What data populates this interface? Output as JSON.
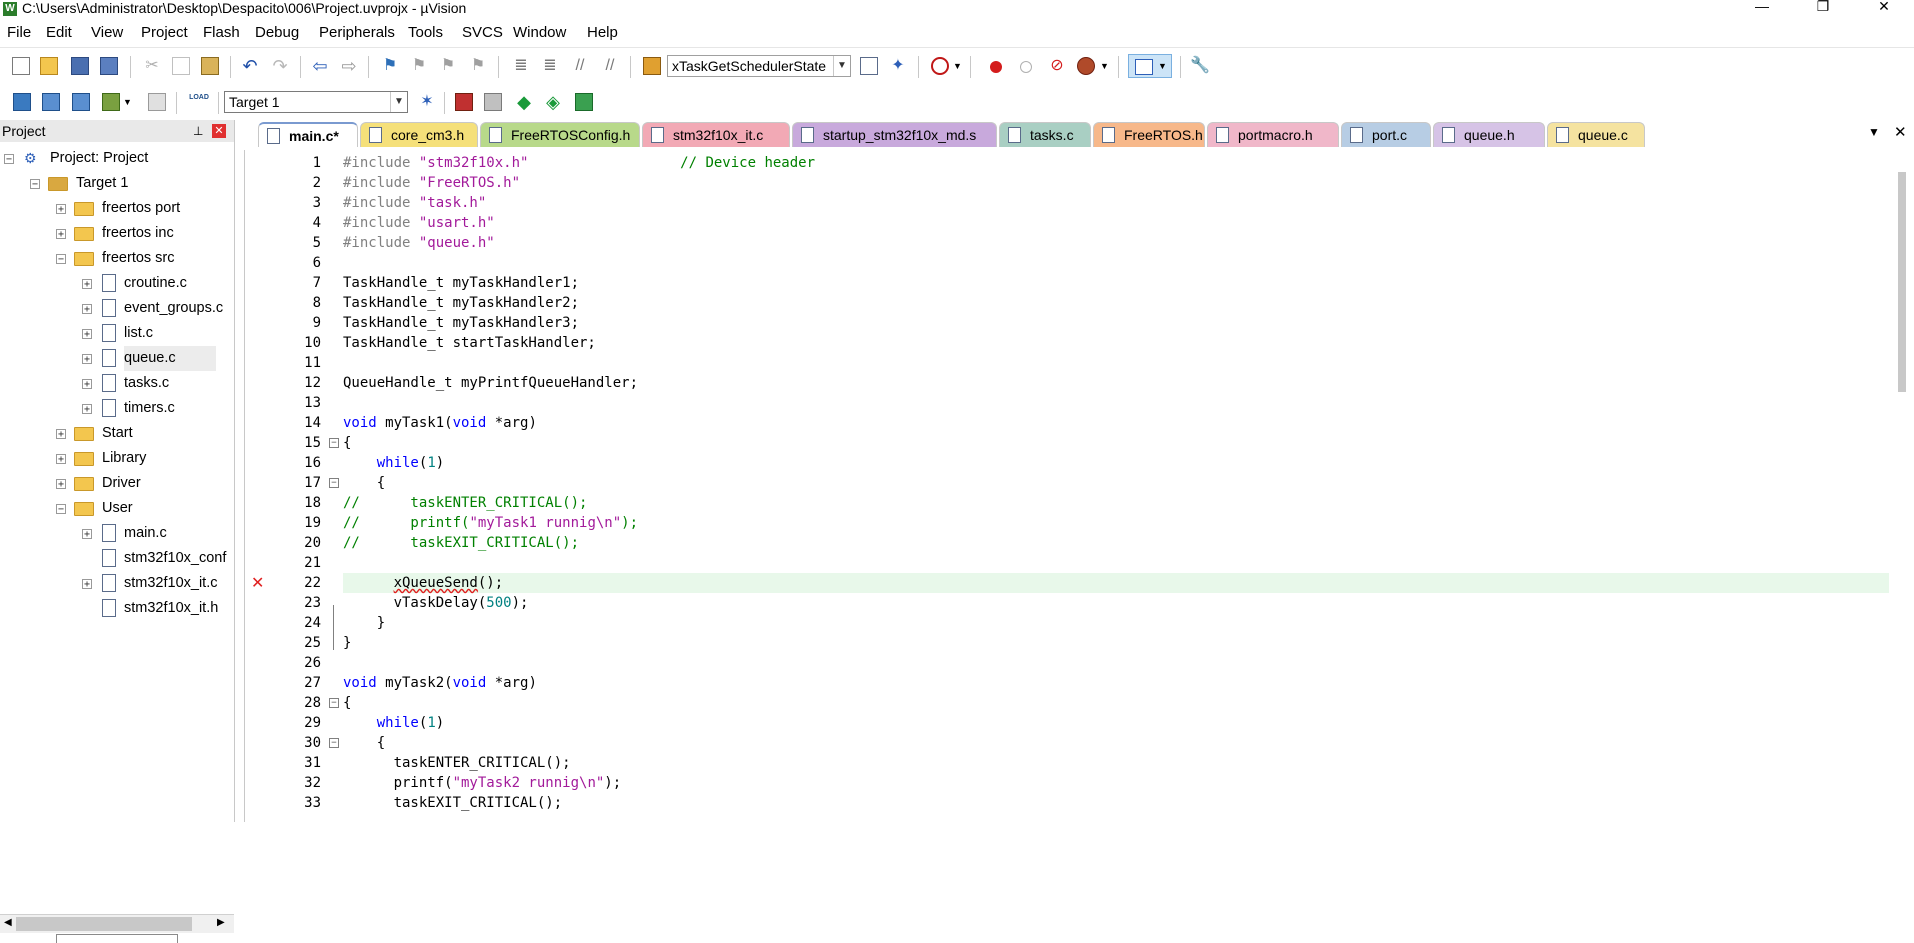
{
  "window": {
    "title": "C:\\Users\\Administrator\\Desktop\\Despacito\\006\\Project.uvprojx - µVision",
    "app_icon": "W",
    "controls": [
      "—",
      "❐",
      "✕"
    ]
  },
  "menu": [
    "File",
    "Edit",
    "View",
    "Project",
    "Flash",
    "Debug",
    "Peripherals",
    "Tools",
    "SVCS",
    "Window",
    "Help"
  ],
  "toolbar": {
    "find_combo": "xTaskGetSchedulerState",
    "target_combo": "Target 1"
  },
  "project_panel": {
    "title": "Project",
    "pin": "⊥",
    "close": "✕",
    "tree": [
      {
        "label": "Project: Project",
        "level": 0,
        "kind": "project",
        "exp": "−"
      },
      {
        "label": "Target 1",
        "level": 1,
        "kind": "target",
        "exp": "−"
      },
      {
        "label": "freertos port",
        "level": 2,
        "kind": "folder",
        "exp": "+"
      },
      {
        "label": "freertos inc",
        "level": 2,
        "kind": "folder",
        "exp": "+"
      },
      {
        "label": "freertos src",
        "level": 2,
        "kind": "folder-open",
        "exp": "−"
      },
      {
        "label": "croutine.c",
        "level": 3,
        "kind": "file",
        "exp": "+"
      },
      {
        "label": "event_groups.c",
        "level": 3,
        "kind": "file",
        "exp": "+"
      },
      {
        "label": "list.c",
        "level": 3,
        "kind": "file",
        "exp": "+"
      },
      {
        "label": "queue.c",
        "level": 3,
        "kind": "file",
        "exp": "+",
        "selected": true
      },
      {
        "label": "tasks.c",
        "level": 3,
        "kind": "file",
        "exp": "+"
      },
      {
        "label": "timers.c",
        "level": 3,
        "kind": "file",
        "exp": "+"
      },
      {
        "label": "Start",
        "level": 2,
        "kind": "folder",
        "exp": "+"
      },
      {
        "label": "Library",
        "level": 2,
        "kind": "folder",
        "exp": "+"
      },
      {
        "label": "Driver",
        "level": 2,
        "kind": "folder",
        "exp": "+"
      },
      {
        "label": "User",
        "level": 2,
        "kind": "folder-open",
        "exp": "−"
      },
      {
        "label": "main.c",
        "level": 3,
        "kind": "file",
        "exp": "+"
      },
      {
        "label": "stm32f10x_conf",
        "level": 3,
        "kind": "file",
        "exp": ""
      },
      {
        "label": "stm32f10x_it.c",
        "level": 3,
        "kind": "file",
        "exp": "+"
      },
      {
        "label": "stm32f10x_it.h",
        "level": 3,
        "kind": "file",
        "exp": ""
      }
    ]
  },
  "tabs": [
    {
      "label": "main.c*",
      "color": "#ffffff",
      "active": true,
      "width": 100
    },
    {
      "label": "core_cm3.h",
      "color": "#f5e07a",
      "width": 118
    },
    {
      "label": "FreeRTOSConfig.h",
      "color": "#b8d98a",
      "width": 160
    },
    {
      "label": "stm32f10x_it.c",
      "color": "#f2a9b5",
      "width": 148
    },
    {
      "label": "startup_stm32f10x_md.s",
      "color": "#c8a9dc",
      "width": 205
    },
    {
      "label": "tasks.c",
      "color": "#a9cfc3",
      "width": 92
    },
    {
      "label": "FreeRTOS.h",
      "color": "#f7b88a",
      "width": 112
    },
    {
      "label": "portmacro.h",
      "color": "#f0b7c9",
      "width": 132
    },
    {
      "label": "port.c",
      "color": "#b7cde4",
      "width": 90
    },
    {
      "label": "queue.h",
      "color": "#d6c3e6",
      "width": 112
    },
    {
      "label": "queue.c",
      "color": "#f5e3a0",
      "width": 98
    }
  ],
  "tabs_overflow": "▼",
  "tabs_close": "✕",
  "error_marker": "✕",
  "code_lines": [
    {
      "n": "1",
      "html": "<span class=\"pp\">#include </span><span class=\"str\">\"stm32f10x.h\"</span>                  <span class=\"cmt\">// Device header</span>"
    },
    {
      "n": "2",
      "html": "<span class=\"pp\">#include </span><span class=\"str\">\"FreeRTOS.h\"</span>"
    },
    {
      "n": "3",
      "html": "<span class=\"pp\">#include </span><span class=\"str\">\"task.h\"</span>"
    },
    {
      "n": "4",
      "html": "<span class=\"pp\">#include </span><span class=\"str\">\"usart.h\"</span>"
    },
    {
      "n": "5",
      "html": "<span class=\"pp\">#include </span><span class=\"str\">\"queue.h\"</span>"
    },
    {
      "n": "6",
      "html": ""
    },
    {
      "n": "7",
      "html": "TaskHandle_t myTaskHandler1;"
    },
    {
      "n": "8",
      "html": "TaskHandle_t myTaskHandler2;"
    },
    {
      "n": "9",
      "html": "TaskHandle_t myTaskHandler3;"
    },
    {
      "n": "10",
      "html": "TaskHandle_t startTaskHandler;"
    },
    {
      "n": "11",
      "html": ""
    },
    {
      "n": "12",
      "html": "QueueHandle_t myPrintfQueueHandler;"
    },
    {
      "n": "13",
      "html": ""
    },
    {
      "n": "14",
      "html": "<span class=\"kw\">void</span> myTask1(<span class=\"kw\">void</span> *arg)"
    },
    {
      "n": "15",
      "html": "{"
    },
    {
      "n": "16",
      "html": "    <span class=\"kw\">while</span>(<span class=\"num\">1</span>)"
    },
    {
      "n": "17",
      "html": "    {"
    },
    {
      "n": "18",
      "html": "<span class=\"cmt\">//      taskENTER_CRITICAL();</span>"
    },
    {
      "n": "19",
      "html": "<span class=\"cmt\">//      printf(</span><span class=\"str\">\"myTask1 runnig\\n\"</span><span class=\"cmt\">);</span>"
    },
    {
      "n": "20",
      "html": "<span class=\"cmt\">//      taskEXIT_CRITICAL();</span>"
    },
    {
      "n": "21",
      "html": ""
    },
    {
      "n": "22",
      "html": "      <span style=\"text-decoration:underline wavy #e02020\">xQueueSend</span>();",
      "highlight": true,
      "error": true
    },
    {
      "n": "23",
      "html": "      vTaskDelay(<span class=\"num\">500</span>);"
    },
    {
      "n": "24",
      "html": "    }"
    },
    {
      "n": "25",
      "html": "}"
    },
    {
      "n": "26",
      "html": ""
    },
    {
      "n": "27",
      "html": "<span class=\"kw\">void</span> myTask2(<span class=\"kw\">void</span> *arg)"
    },
    {
      "n": "28",
      "html": "{"
    },
    {
      "n": "29",
      "html": "    <span class=\"kw\">while</span>(<span class=\"num\">1</span>)"
    },
    {
      "n": "30",
      "html": "    {"
    },
    {
      "n": "31",
      "html": "      taskENTER_CRITICAL();"
    },
    {
      "n": "32",
      "html": "      printf(<span class=\"str\">\"myTask2 runnig\\n\"</span>);"
    },
    {
      "n": "33",
      "html": "      taskEXIT_CRITICAL();"
    }
  ],
  "colors": {
    "highlight_line": "#e8f8ea",
    "error_red": "#e02020",
    "toolbar_active": "#cce4f7"
  }
}
